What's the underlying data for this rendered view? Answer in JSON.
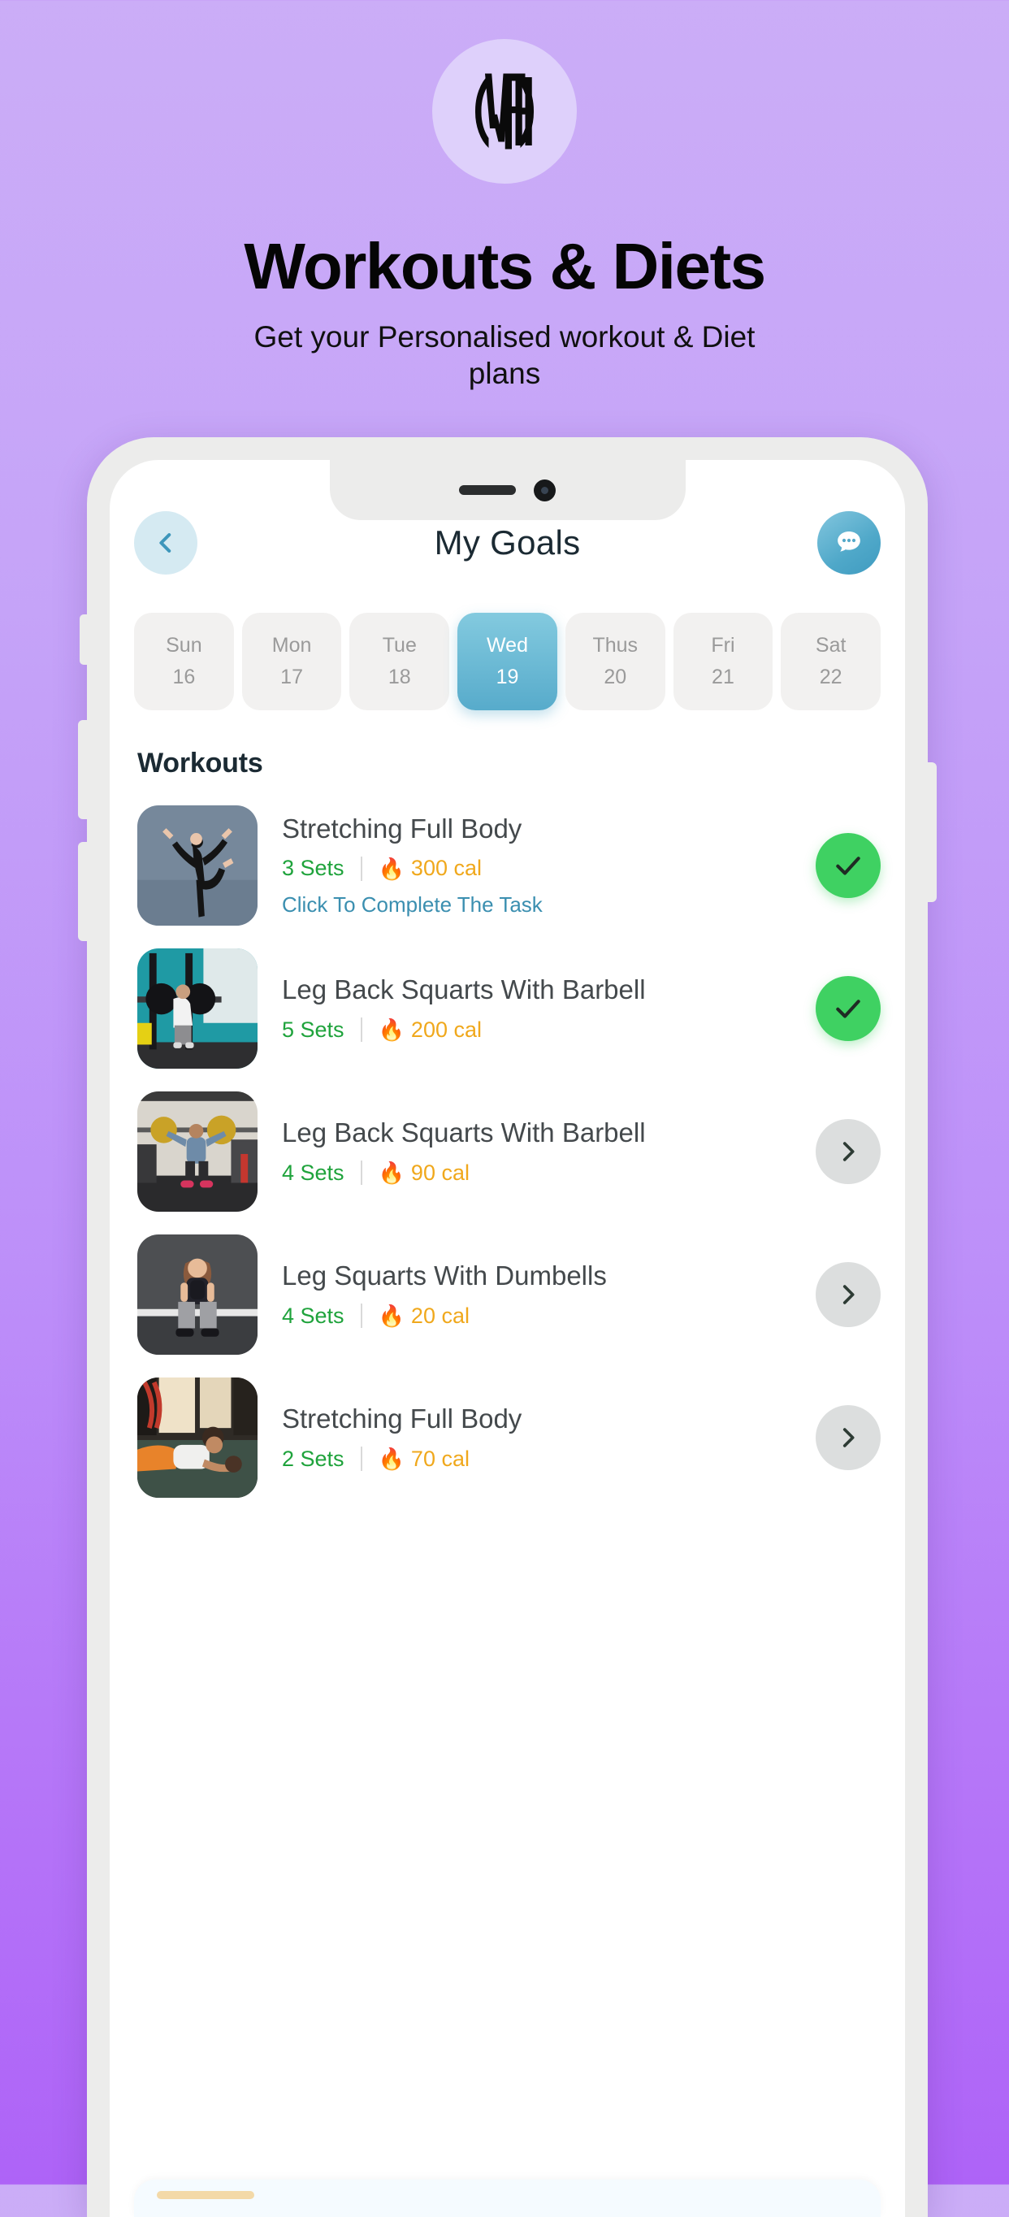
{
  "hero": {
    "logo_text": "WFH",
    "logo_icon": "wfh-monogram-logo",
    "title": "Workouts & Diets",
    "subtitle": "Get your Personalised workout & Diet plans"
  },
  "colors": {
    "bg_top": "#cbadf7",
    "bg_bottom": "#ae63f7",
    "logo_badge": "#ded0fb",
    "accent_teal": "#4fa8c9",
    "accent_back_bg": "#d5eaf2",
    "sets_green": "#1fa33c",
    "cal_orange": "#f0a81c",
    "done_green": "#3fd162",
    "next_gray": "#dcdede",
    "hint_blue": "#3b8fb0",
    "title_navy": "#1b2a33",
    "pill_idle": "#f2f1f0",
    "pill_text_idle": "#9a9a9a"
  },
  "app": {
    "header": {
      "back_icon": "chevron-left-icon",
      "title": "My Goals",
      "chat_icon": "chat-bubble-dots-icon"
    },
    "days": [
      {
        "dow": "Sun",
        "num": "16",
        "selected": false
      },
      {
        "dow": "Mon",
        "num": "17",
        "selected": false
      },
      {
        "dow": "Tue",
        "num": "18",
        "selected": false
      },
      {
        "dow": "Wed",
        "num": "19",
        "selected": true
      },
      {
        "dow": "Thus",
        "num": "20",
        "selected": false
      },
      {
        "dow": "Fri",
        "num": "21",
        "selected": false
      },
      {
        "dow": "Sat",
        "num": "22",
        "selected": false
      }
    ],
    "section_title": "Workouts",
    "flame_icon": "flame-icon",
    "workouts": [
      {
        "name": "Stretching Full Body",
        "sets": "3 Sets",
        "calories": "300 cal",
        "hint": "Click To Complete The Task",
        "status": "done",
        "action_icon": "check-icon",
        "thumb": "yoga-dancer-pose"
      },
      {
        "name": "Leg Back Squarts With Barbell",
        "sets": "5 Sets",
        "calories": "200 cal",
        "hint": "",
        "status": "done",
        "action_icon": "check-icon",
        "thumb": "barbell-squat-rack-teal"
      },
      {
        "name": "Leg Back Squarts With Barbell",
        "sets": "4 Sets",
        "calories": "90 cal",
        "hint": "",
        "status": "next",
        "action_icon": "chevron-right-icon",
        "thumb": "garage-gym-overhead-squat"
      },
      {
        "name": "Leg Squarts With Dumbells",
        "sets": "4 Sets",
        "calories": "20 cal",
        "hint": "",
        "status": "next",
        "action_icon": "chevron-right-icon",
        "thumb": "woman-goblet-squat-gray"
      },
      {
        "name": "Stretching Full Body",
        "sets": "2 Sets",
        "calories": "70 cal",
        "hint": "",
        "status": "next",
        "action_icon": "chevron-right-icon",
        "thumb": "floor-stretch-roller"
      }
    ]
  }
}
